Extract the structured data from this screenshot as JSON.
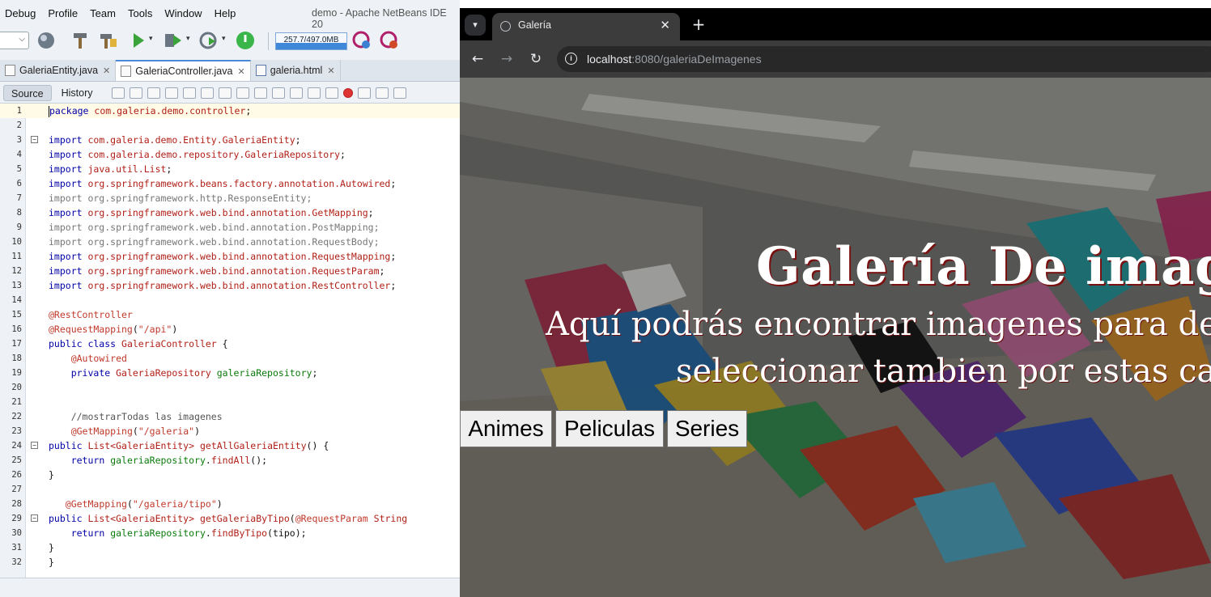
{
  "ide": {
    "menu": [
      "Debug",
      "Profile",
      "Team",
      "Tools",
      "Window",
      "Help"
    ],
    "window_title": "demo - Apache NetBeans IDE 20",
    "memory": "257.7/497.0MB",
    "tabs": [
      {
        "label": "GaleriaEntity.java",
        "active": false
      },
      {
        "label": "GaleriaController.java",
        "active": true
      },
      {
        "label": "galeria.html",
        "active": false
      }
    ],
    "source_label": "Source",
    "history_label": "History",
    "code": [
      {
        "n": "1",
        "html": "<span class='caret'></span><span class='k'>package</span> <span class='p'>com.galeria.demo.controller</span>;",
        "cur": true
      },
      {
        "n": "2",
        "html": ""
      },
      {
        "n": "3",
        "html": "<span class='k'>import</span> <span class='p'>com.galeria.demo.Entity.GaleriaEntity</span>;",
        "fold": "-"
      },
      {
        "n": "4",
        "html": "<span class='k'>import</span> <span class='p'>com.galeria.demo.repository.GaleriaRepository</span>;"
      },
      {
        "n": "5",
        "html": "<span class='k'>import</span> <span class='p'>java.util.List</span>;"
      },
      {
        "n": "6",
        "html": "<span class='k'>import</span> <span class='p'>org.springframework.beans.factory.annotation.Autowired</span>;"
      },
      {
        "n": "7",
        "html": "<span class='g'>import org.springframework.http.ResponseEntity;</span>"
      },
      {
        "n": "8",
        "html": "<span class='k'>import</span> <span class='p'>org.springframework.web.bind.annotation.GetMapping</span>;"
      },
      {
        "n": "9",
        "html": "<span class='g'>import org.springframework.web.bind.annotation.PostMapping;</span>"
      },
      {
        "n": "10",
        "html": "<span class='g'>import org.springframework.web.bind.annotation.RequestBody;</span>"
      },
      {
        "n": "11",
        "html": "<span class='k'>import</span> <span class='p'>org.springframework.web.bind.annotation.RequestMapping</span>;"
      },
      {
        "n": "12",
        "html": "<span class='k'>import</span> <span class='p'>org.springframework.web.bind.annotation.RequestParam</span>;"
      },
      {
        "n": "13",
        "html": "<span class='k'>import</span> <span class='p'>org.springframework.web.bind.annotation.RestController</span>;"
      },
      {
        "n": "14",
        "html": ""
      },
      {
        "n": "15",
        "html": "<span class='a'>@RestController</span>"
      },
      {
        "n": "16",
        "html": "<span class='a'>@RequestMapping</span>(<span class='str'>\"/api\"</span>)"
      },
      {
        "n": "17",
        "html": "<span class='k'>public class</span> <span class='p'>GaleriaController</span> {"
      },
      {
        "n": "18",
        "html": "    <span class='a'>@Autowired</span>"
      },
      {
        "n": "19",
        "html": "    <span class='k'>private</span> <span class='p'>GaleriaRepository</span> <span class='fld'>galeriaRepository</span>;"
      },
      {
        "n": "20",
        "html": ""
      },
      {
        "n": "21",
        "html": ""
      },
      {
        "n": "22",
        "html": "    <span class='c'>//mostrarTodas las imagenes</span>"
      },
      {
        "n": "23",
        "html": "    <span class='a'>@GetMapping</span>(<span class='str'>\"/galeria\"</span>)"
      },
      {
        "n": "24",
        "html": "<span class='k'>public</span> <span class='p'>List&lt;GaleriaEntity&gt;</span> <span class='p'>getAllGaleriaEntity</span>() {",
        "fold": "-"
      },
      {
        "n": "25",
        "html": "    <span class='k'>return</span> <span class='fld'>galeriaRepository</span>.<span class='p'>findAll</span>();"
      },
      {
        "n": "26",
        "html": "}"
      },
      {
        "n": "27",
        "html": ""
      },
      {
        "n": "28",
        "html": "   <span class='a'>@GetMapping</span>(<span class='str'>\"/galeria/tipo\"</span>)"
      },
      {
        "n": "29",
        "html": "<span class='k'>public</span> <span class='p'>List&lt;GaleriaEntity&gt;</span> <span class='p'>getGaleriaByTipo</span>(<span class='a'>@RequestParam</span> <span class='p'>String</span>",
        "fold": "-"
      },
      {
        "n": "30",
        "html": "    <span class='k'>return</span> <span class='fld'>galeriaRepository</span>.<span class='p'>findByTipo</span>(tipo);"
      },
      {
        "n": "31",
        "html": "}"
      },
      {
        "n": "32",
        "html": "}"
      }
    ]
  },
  "browser": {
    "tab_title": "Galería",
    "url_host": "localhost",
    "url_rest": ":8080/galeriaDeImagenes",
    "page": {
      "title": "Galería De imagen",
      "subtitle_line1": "Aquí podrás encontrar imagenes para des",
      "subtitle_line2": "seleccionar tambien por estas cat",
      "buttons": [
        "Animes",
        "Peliculas",
        "Series"
      ]
    }
  }
}
